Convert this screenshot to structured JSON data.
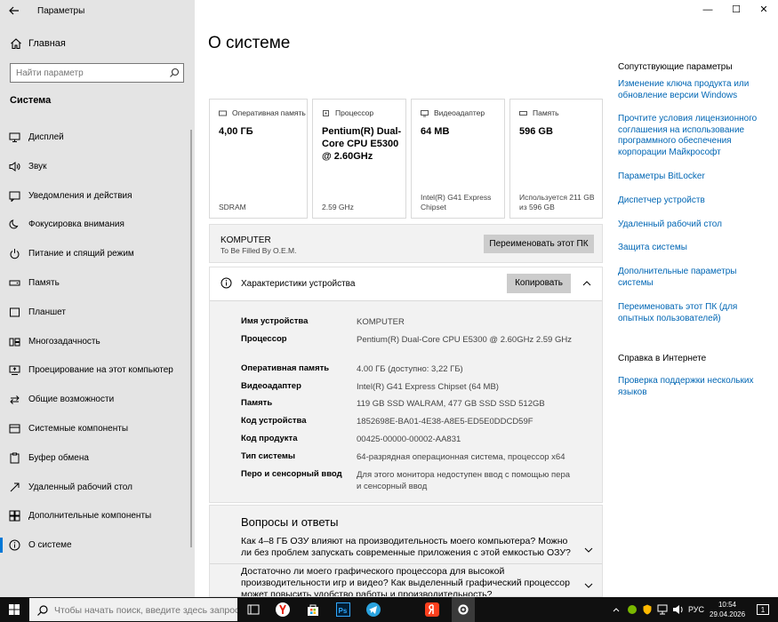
{
  "window": {
    "app_title": "Параметры",
    "controls": {
      "minimize": "—",
      "maximize": "☐",
      "close": "✕"
    }
  },
  "sidebar": {
    "home_label": "Главная",
    "search_placeholder": "Найти параметр",
    "section": "Система",
    "items": [
      {
        "label": "Дисплей",
        "icon": "display-icon"
      },
      {
        "label": "Звук",
        "icon": "sound-icon"
      },
      {
        "label": "Уведомления и действия",
        "icon": "notifications-icon"
      },
      {
        "label": "Фокусировка внимания",
        "icon": "focus-assist-icon"
      },
      {
        "label": "Питание и спящий режим",
        "icon": "power-icon"
      },
      {
        "label": "Память",
        "icon": "storage-icon"
      },
      {
        "label": "Планшет",
        "icon": "tablet-icon"
      },
      {
        "label": "Многозадачность",
        "icon": "multitasking-icon"
      },
      {
        "label": "Проецирование на этот компьютер",
        "icon": "projecting-icon"
      },
      {
        "label": "Общие возможности",
        "icon": "shared-experiences-icon"
      },
      {
        "label": "Системные компоненты",
        "icon": "system-components-icon"
      },
      {
        "label": "Буфер обмена",
        "icon": "clipboard-icon"
      },
      {
        "label": "Удаленный рабочий стол",
        "icon": "remote-desktop-icon"
      },
      {
        "label": "Дополнительные компоненты",
        "icon": "optional-features-icon"
      },
      {
        "label": "О системе",
        "icon": "about-icon",
        "active": true
      }
    ]
  },
  "main": {
    "title": "О системе",
    "cards": [
      {
        "head": "Оперативная память",
        "value": "4,00 ГБ",
        "sub": "SDRAM"
      },
      {
        "head": "Процессор",
        "value": "Pentium(R) Dual-Core  CPU  E5300  @ 2.60GHz",
        "sub": "2.59 GHz"
      },
      {
        "head": "Видеоадаптер",
        "value": "64 MB",
        "sub": "Intel(R) G41 Express Chipset"
      },
      {
        "head": "Память",
        "value": "596 GB",
        "sub": "Используется 211 GB из 596 GB"
      }
    ],
    "pc": {
      "name": "KOMPUTER",
      "subtitle": "To Be Filled By O.E.M.",
      "rename_button": "Переименовать этот ПК"
    },
    "specs": {
      "title": "Характеристики устройства",
      "copy_button": "Копировать",
      "rows": [
        {
          "key": "Имя устройства",
          "value": "KOMPUTER"
        },
        {
          "key": "Процессор",
          "value": "Pentium(R) Dual-Core  CPU    E5300  @ 2.60GHz    2.59 GHz"
        },
        {
          "key": "Оперативная память",
          "value": "4.00 ГБ (доступно: 3,22 ГБ)"
        },
        {
          "key": "Видеоадаптер",
          "value": "Intel(R) G41 Express Chipset (64 MB)"
        },
        {
          "key": "Память",
          "value": "119 GB SSD WALRAM, 477 GB SSD SSD 512GB"
        },
        {
          "key": "Код устройства",
          "value": "1852698E-BA01-4E38-A8E5-ED5E0DDCD59F"
        },
        {
          "key": "Код продукта",
          "value": "00425-00000-00002-AA831"
        },
        {
          "key": "Тип системы",
          "value": "64-разрядная операционная система, процессор x64"
        },
        {
          "key": "Перо и сенсорный ввод",
          "value": "Для этого монитора недоступен ввод с помощью пера и сенсорный ввод"
        }
      ]
    },
    "qa": {
      "title": "Вопросы и ответы",
      "items": [
        "Как 4–8 ГБ ОЗУ влияют на производительность моего компьютера? Можно ли без проблем запускать современные приложения с этой емкостью ОЗУ?",
        "Достаточно ли моего графического процессора для высокой производительности игр и видео? Как выделенный графический процессор может повысить удобство работы и производительность?"
      ]
    }
  },
  "related": {
    "heading": "Сопутствующие параметры",
    "links": [
      "Изменение ключа продукта или обновление версии Windows",
      "Прочтите условия лицензионного соглашения на использование программного обеспечения корпорации Майкрософт",
      "Параметры BitLocker",
      "Диспетчер устройств",
      "Удаленный рабочий стол",
      "Защита системы",
      "Дополнительные параметры системы",
      "Переименовать этот ПК (для опытных пользователей)"
    ],
    "help_heading": "Справка в Интернете",
    "help_links": [
      "Проверка поддержки нескольких языков"
    ]
  },
  "taskbar": {
    "search_placeholder": "Чтобы начать поиск, введите здесь запрос",
    "apps": [
      "task-view-icon",
      "yandex-browser-icon",
      "store-icon",
      "photoshop-icon",
      "telegram-icon",
      "yandex-icon",
      "settings-icon"
    ],
    "language": "РУС",
    "time": "10:54",
    "date": "29.04.2026",
    "notification_count": "1",
    "colors": {
      "accent": "#0078d7",
      "link": "#0066b4"
    }
  }
}
